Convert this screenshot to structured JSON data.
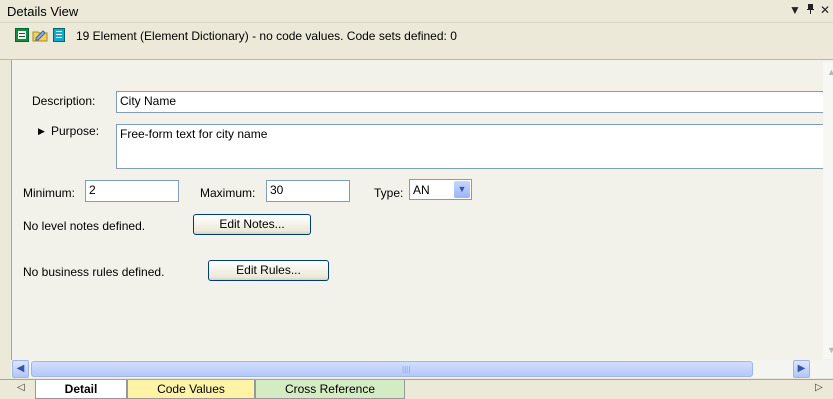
{
  "window": {
    "title": "Details View",
    "dropdown_icon": "▼",
    "pin_icon": "ᵖ",
    "close_icon": "✕"
  },
  "info": {
    "text": "19 Element (Element Dictionary) - no code values.  Code sets defined: 0"
  },
  "form": {
    "description_label": "Description:",
    "description_value": "City Name",
    "purpose_label": "Purpose:",
    "purpose_value": "Free-form text for city name",
    "minimum_label": "Minimum:",
    "minimum_value": "2",
    "maximum_label": "Maximum:",
    "maximum_value": "30",
    "type_label": "Type:",
    "type_value": "AN",
    "notes_text": "No level notes defined.",
    "edit_notes_label": "Edit Notes...",
    "rules_text": "No business rules defined.",
    "edit_rules_label": "Edit Rules..."
  },
  "tabs": [
    {
      "label": "Detail",
      "active": true
    },
    {
      "label": "Code Values",
      "active": false
    },
    {
      "label": "Cross Reference",
      "active": false
    }
  ],
  "colors": {
    "tab_detail": "#ffffff",
    "tab_codes": "#fff3a8",
    "tab_xref": "#d4ecc3"
  }
}
